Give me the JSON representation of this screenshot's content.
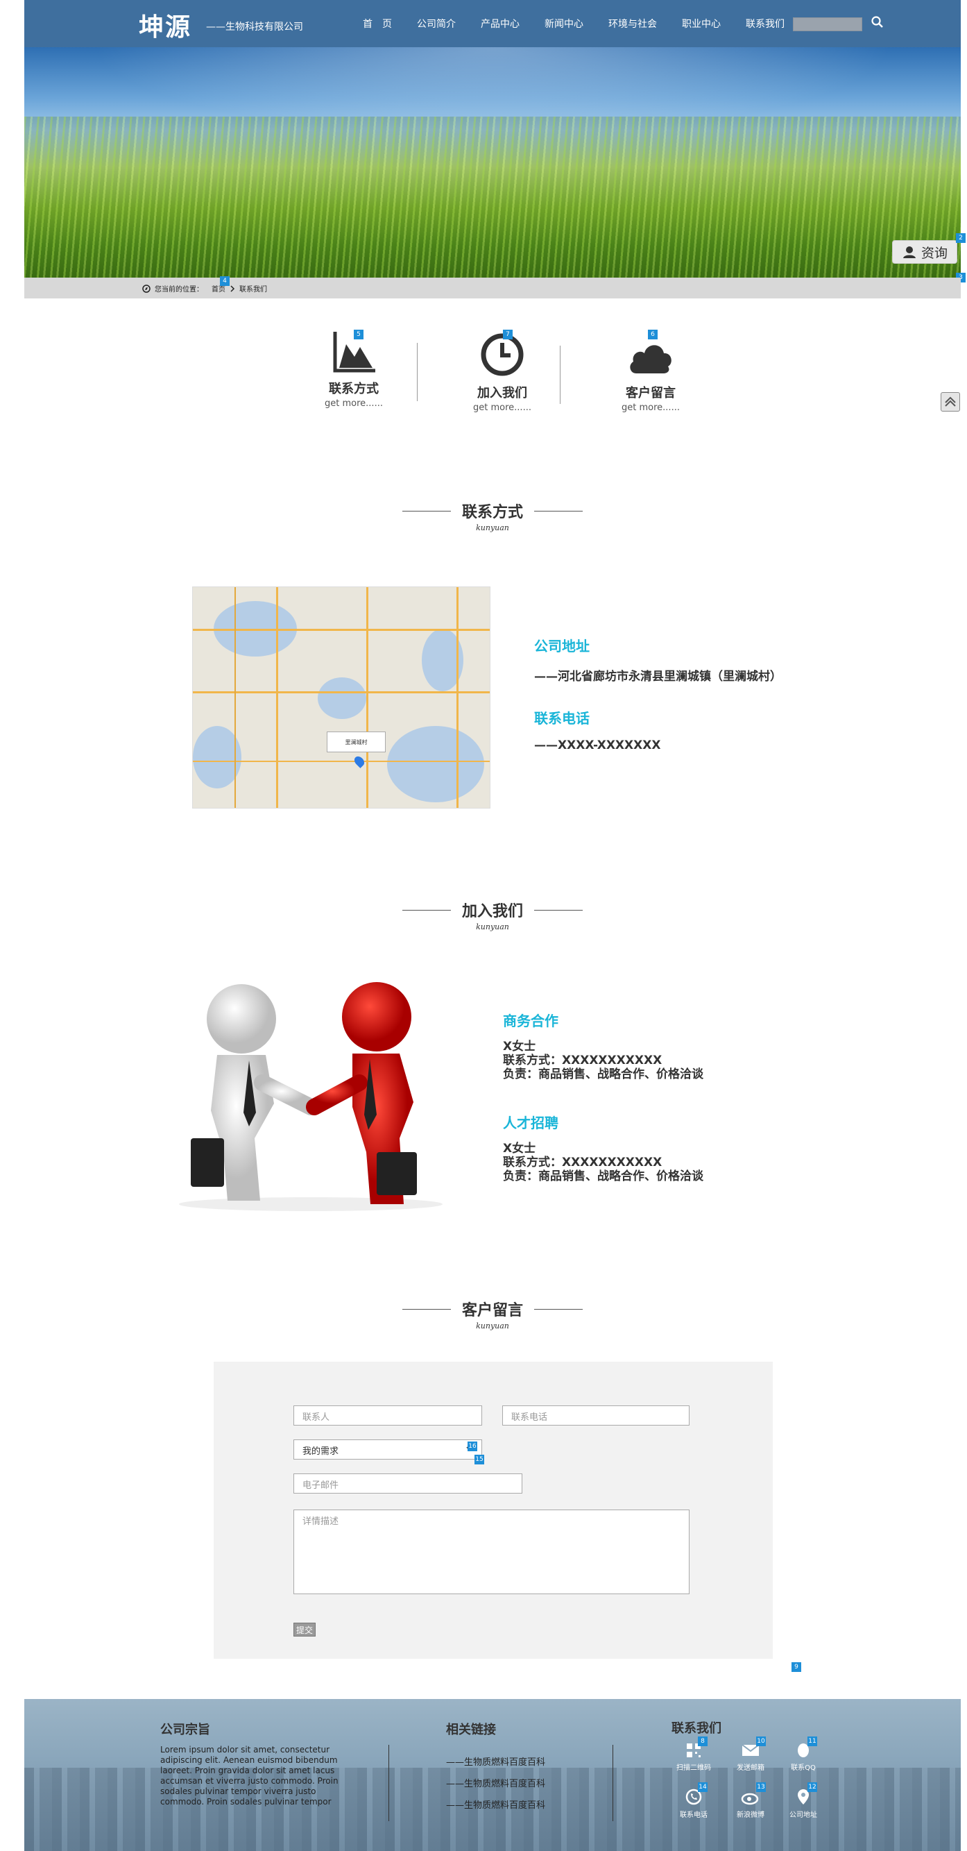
{
  "header": {
    "logo": "坤源",
    "logo_sub": "——生物科技有限公司",
    "nav": [
      "首　页",
      "公司简介",
      "产品中心",
      "新闻中心",
      "环境与社会",
      "职业中心",
      "联系我们"
    ],
    "search_placeholder": ""
  },
  "hero": {
    "consult_label": "资询"
  },
  "breadcrumb": {
    "prefix": "您当前的位置：",
    "home": "首页",
    "current": "联系我们"
  },
  "categories": [
    {
      "title": "联系方式",
      "more": "get more......",
      "icon": "chart-icon"
    },
    {
      "title": "加入我们",
      "more": "get more......",
      "icon": "clock-icon"
    },
    {
      "title": "客户留言",
      "more": "get more......",
      "icon": "cloud-icon"
    }
  ],
  "sections": {
    "contact": {
      "title": "联系方式",
      "sub": "kunyuan"
    },
    "join": {
      "title": "加入我们",
      "sub": "kunyuan"
    },
    "message": {
      "title": "客户留言",
      "sub": "kunyuan"
    }
  },
  "map": {
    "popup": "里澜城村"
  },
  "contact_info": {
    "addr_label": "公司地址",
    "addr_value": "——河北省廊坊市永清县里澜城镇（里澜城村）",
    "phone_label": "联系电话",
    "phone_value": "——XXXX-XXXXXXX"
  },
  "join_info": {
    "business": {
      "label": "商务合作",
      "name": "X女士",
      "contact": "联系方式：XXXXXXXXXXX",
      "duty": "负责：商品销售、战略合作、价格洽谈"
    },
    "talent": {
      "label": "人才招聘",
      "name": "X女士",
      "contact": "联系方式：XXXXXXXXXXX",
      "duty": "负责：商品销售、战略合作、价格洽谈"
    }
  },
  "form": {
    "name_placeholder": "联系人",
    "phone_placeholder": "联系电话",
    "need_selected": "我的需求",
    "email_placeholder": "电子邮件",
    "detail_placeholder": "详情描述",
    "submit": "提交"
  },
  "footer": {
    "about_title": "公司宗旨",
    "about_text": "Lorem ipsum dolor sit amet, consectetur adipiscing elit. Aenean euismod bibendum laoreet. Proin gravida dolor sit amet lacus accumsan et viverra justo commodo. Proin sodales pulvinar tempor viverra justo commodo. Proin sodales pulvinar tempor",
    "links_title": "相关链接",
    "links": [
      "——生物质燃料百度百科",
      "——生物质燃料百度百科",
      "——生物质燃料百度百科"
    ],
    "contact_title": "联系我们",
    "icons": [
      {
        "label": "扫描二维码",
        "badge": "8"
      },
      {
        "label": "发送邮箱",
        "badge": "10"
      },
      {
        "label": "联系QQ",
        "badge": "11"
      },
      {
        "label": "联系电话",
        "badge": "14"
      },
      {
        "label": "新浪微博",
        "badge": "13"
      },
      {
        "label": "公司地址",
        "badge": "12"
      }
    ]
  },
  "badges": {
    "b2": "2",
    "b3": "3",
    "b4": "4",
    "b5": "5",
    "b6": "6",
    "b7": "7",
    "b9": "9",
    "b15": "15",
    "b16": "16"
  },
  "colors": {
    "header": "#3f6f9e",
    "accent": "#1ab5d8",
    "badge": "#1e8fd8"
  }
}
